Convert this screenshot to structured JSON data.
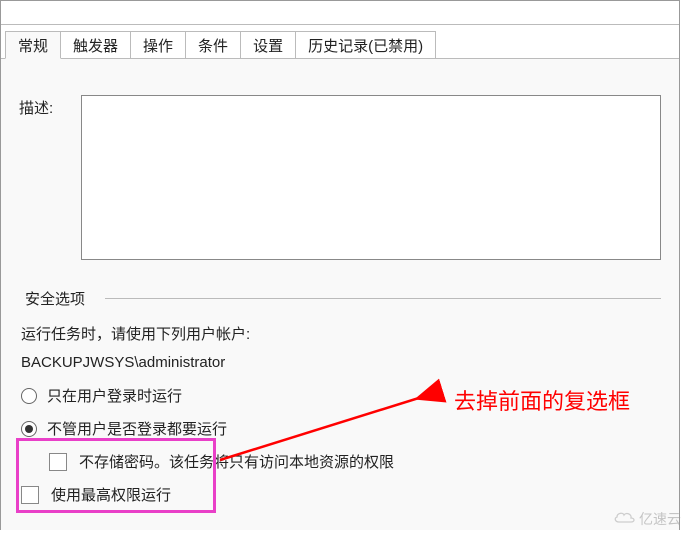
{
  "tabs": {
    "general": "常规",
    "triggers": "触发器",
    "actions": "操作",
    "conditions": "条件",
    "settings": "设置",
    "history": "历史记录(已禁用)"
  },
  "content": {
    "partial_visible": "",
    "description_label": "描述:"
  },
  "security": {
    "group_title": "安全选项",
    "run_as_prompt": "运行任务时，请使用下列用户帐户:",
    "account": "BACKUPJWSYS\\administrator",
    "radio1": "只在用户登录时运行",
    "radio2": "不管用户是否登录都要运行",
    "check1": "不存储密码。该任务将只有访问本地资源的权限",
    "check2": "使用最高权限运行"
  },
  "annotation": {
    "text": "去掉前面的复选框"
  },
  "watermark": {
    "text": "亿速云"
  }
}
